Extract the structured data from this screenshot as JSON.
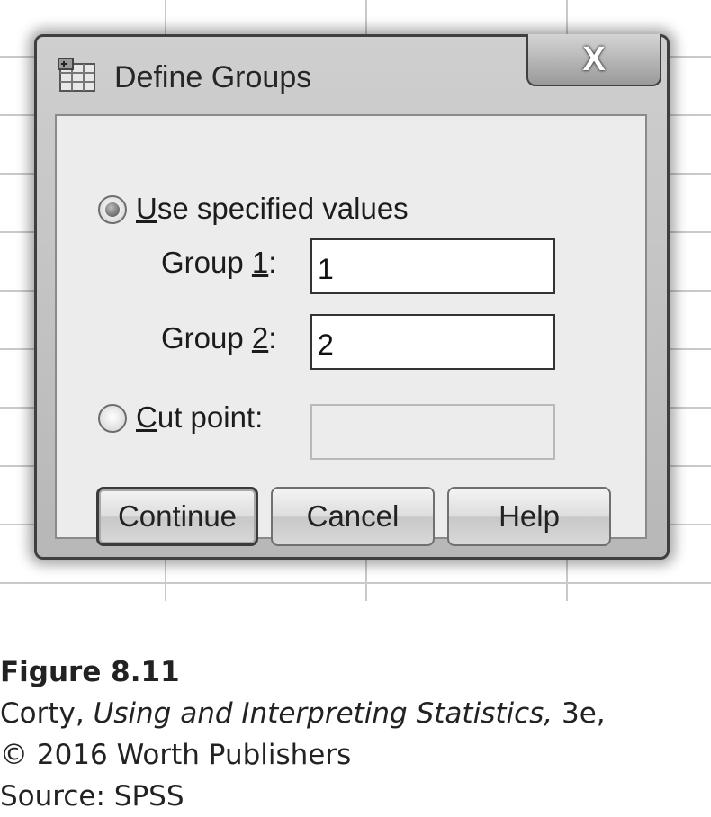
{
  "dialog": {
    "title": "Define Groups",
    "close_label": "X",
    "use_specified_values": {
      "accel": "U",
      "rest": "se specified values",
      "selected": true
    },
    "group1": {
      "prefix": "Group ",
      "accel": "1",
      "suffix": ":",
      "value": "1"
    },
    "group2": {
      "prefix": "Group ",
      "accel": "2",
      "suffix": ":",
      "value": "2"
    },
    "cut_point": {
      "accel": "C",
      "rest": "ut point:",
      "selected": false,
      "value": ""
    },
    "buttons": {
      "continue": "Continue",
      "cancel": "Cancel",
      "help": "Help"
    }
  },
  "caption": {
    "figure": "Figure 8.11",
    "author": "Corty, ",
    "book_title": "Using and Interpreting Statistics,",
    "edition": " 3e,",
    "copyright": "© 2016 Worth Publishers",
    "source": "Source: SPSS"
  },
  "icons": {
    "title_icon": "spss-data-icon",
    "close_icon": "close-icon"
  }
}
